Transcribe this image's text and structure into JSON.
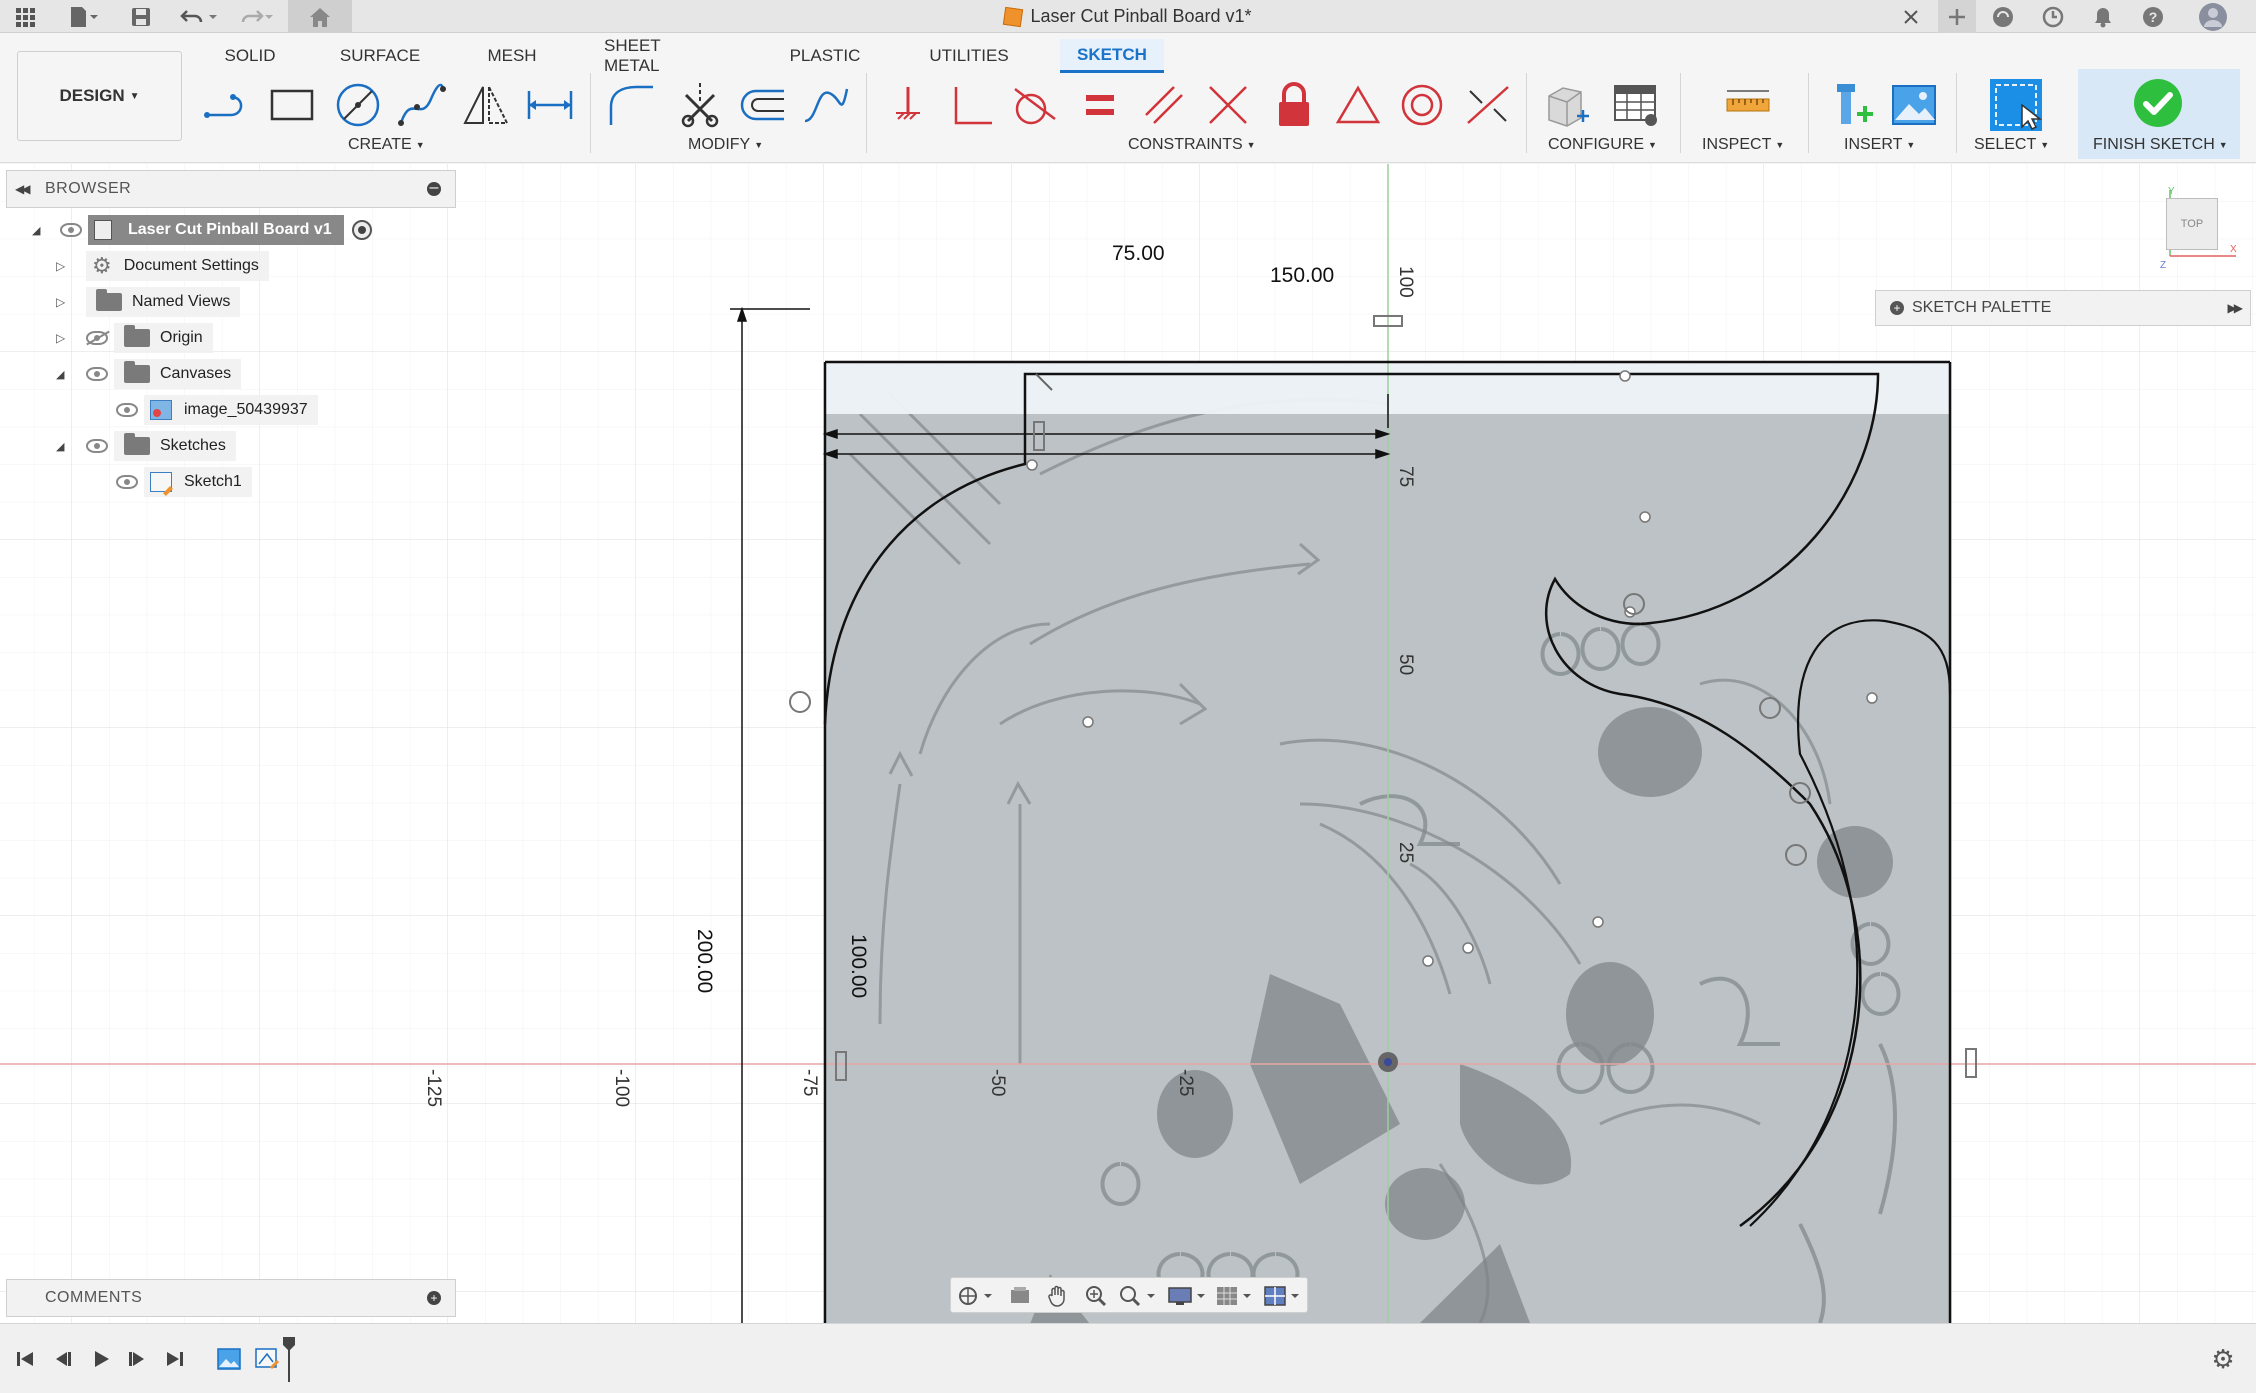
{
  "window": {
    "title": "Laser Cut Pinball Board v1*"
  },
  "ribbon": {
    "workspace": "DESIGN",
    "tabs": [
      "SOLID",
      "SURFACE",
      "MESH",
      "SHEET METAL",
      "PLASTIC",
      "UTILITIES",
      "SKETCH"
    ],
    "active_tab": "SKETCH",
    "groups": [
      "CREATE",
      "MODIFY",
      "CONSTRAINTS",
      "CONFIGURE",
      "INSPECT",
      "INSERT",
      "SELECT",
      "FINISH SKETCH"
    ]
  },
  "browser": {
    "title": "BROWSER",
    "root": "Laser Cut Pinball Board v1",
    "items": [
      "Document Settings",
      "Named Views",
      "Origin",
      "Canvases",
      "image_50439937",
      "Sketches",
      "Sketch1"
    ]
  },
  "comments": {
    "title": "COMMENTS"
  },
  "palette": {
    "title": "SKETCH PALETTE"
  },
  "viewcube": {
    "label": "TOP"
  },
  "sketch": {
    "dimensions": [
      "75.00",
      "150.00",
      "200.00",
      "100.00"
    ],
    "x_ruler": [
      "-125",
      "-100",
      "-75",
      "-50",
      "-25"
    ],
    "y_ruler": [
      "100",
      "75",
      "50",
      "25"
    ]
  },
  "colors": {
    "accent": "#1a73c8",
    "finish": "#2fbf3f",
    "canvas_overlay": "#b9bfc2"
  }
}
